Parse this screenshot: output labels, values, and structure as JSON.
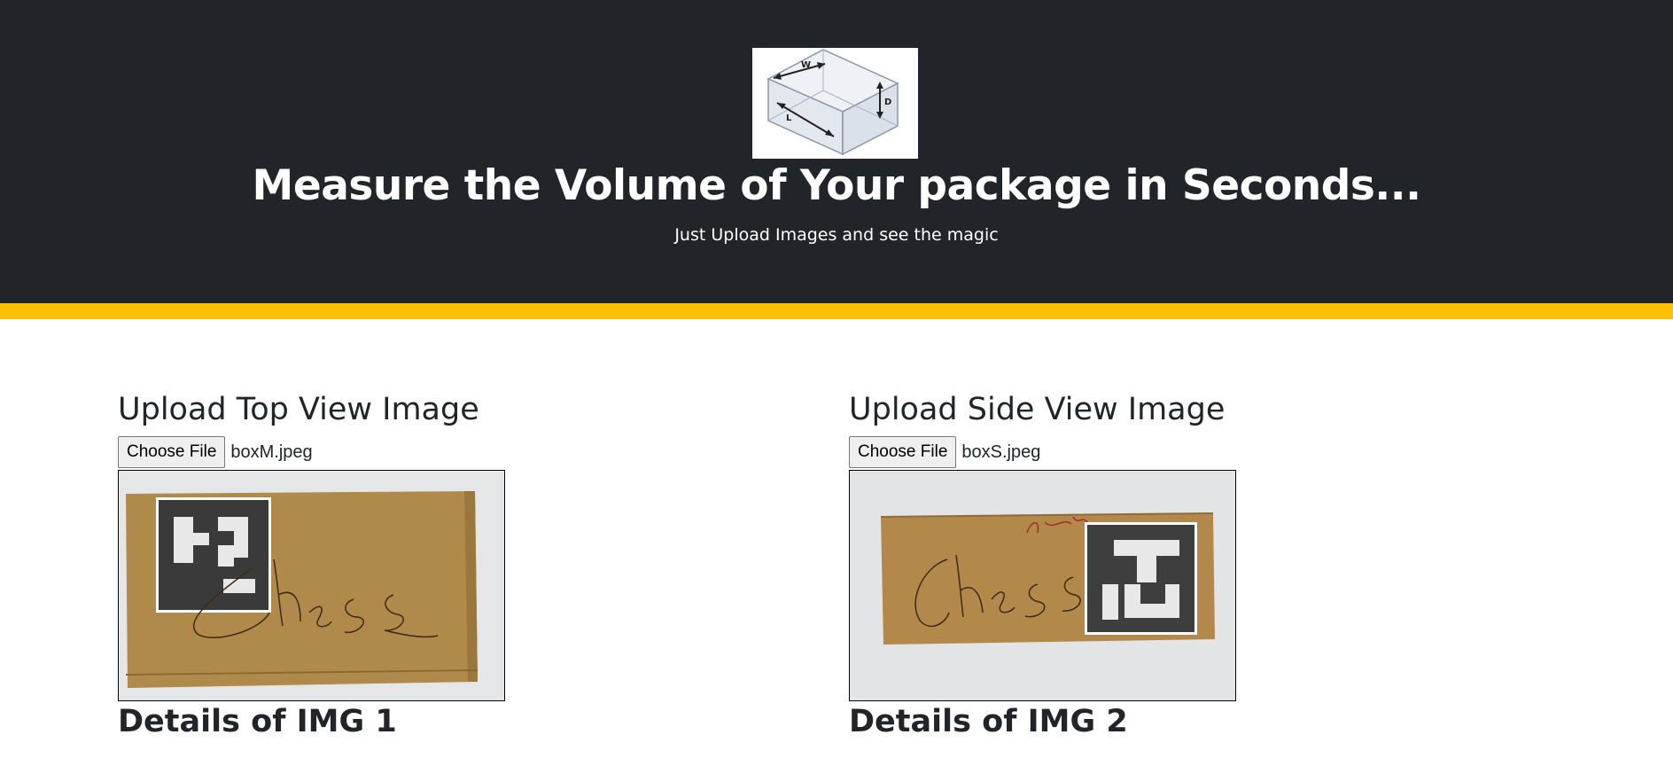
{
  "hero": {
    "title": "Measure the Volume of Your package in Seconds...",
    "subtitle": "Just Upload Images and see the magic",
    "logo_labels": {
      "width": "W",
      "depth": "D",
      "length": "L"
    },
    "accent_color": "#ffc107",
    "background_color": "#212529"
  },
  "top_view": {
    "heading": "Upload Top View Image",
    "button_label": "Choose File",
    "file_name": "boxM.jpeg",
    "details_heading": "Details of IMG 1",
    "box_text": "Chess"
  },
  "side_view": {
    "heading": "Upload Side View Image",
    "button_label": "Choose File",
    "file_name": "boxS.jpeg",
    "details_heading": "Details of IMG 2",
    "box_text": "Chess"
  }
}
